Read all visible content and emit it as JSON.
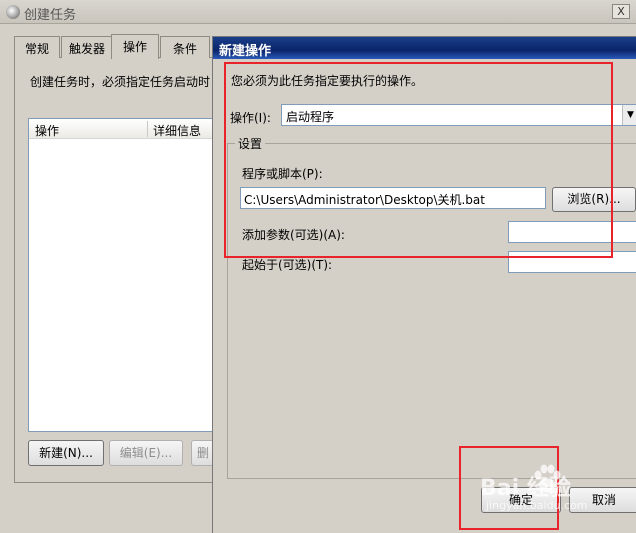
{
  "back_window": {
    "title": "创建任务",
    "close_label": "X",
    "tabs": [
      {
        "label": "常规"
      },
      {
        "label": "触发器"
      },
      {
        "label": "操作"
      },
      {
        "label": "条件"
      }
    ],
    "description": "创建任务时，必须指定任务启动时",
    "list_columns": [
      "操作",
      "详细信息"
    ],
    "buttons": {
      "new": "新建(N)...",
      "edit": "编辑(E)...",
      "delete_partial": "删"
    }
  },
  "dialog": {
    "title": "新建操作",
    "prompt": "您必须为此任务指定要执行的操作。",
    "action_label": "操作(I):",
    "action_value": "启动程序",
    "settings_title": "设置",
    "program_label": "程序或脚本(P):",
    "program_value": "C:\\Users\\Administrator\\Desktop\\关机.bat",
    "browse_label": "浏览(R)...",
    "args_label": "添加参数(可选)(A):",
    "args_value": "",
    "start_in_label": "起始于(可选)(T):",
    "start_in_value": "",
    "ok_label": "确定",
    "cancel_label": "取消"
  },
  "watermark": {
    "text": "Bai 经验",
    "sub": "jingyan.baidu.com"
  },
  "colors": {
    "highlight_red": "#e8232a",
    "title_blue": "#0a246a"
  }
}
